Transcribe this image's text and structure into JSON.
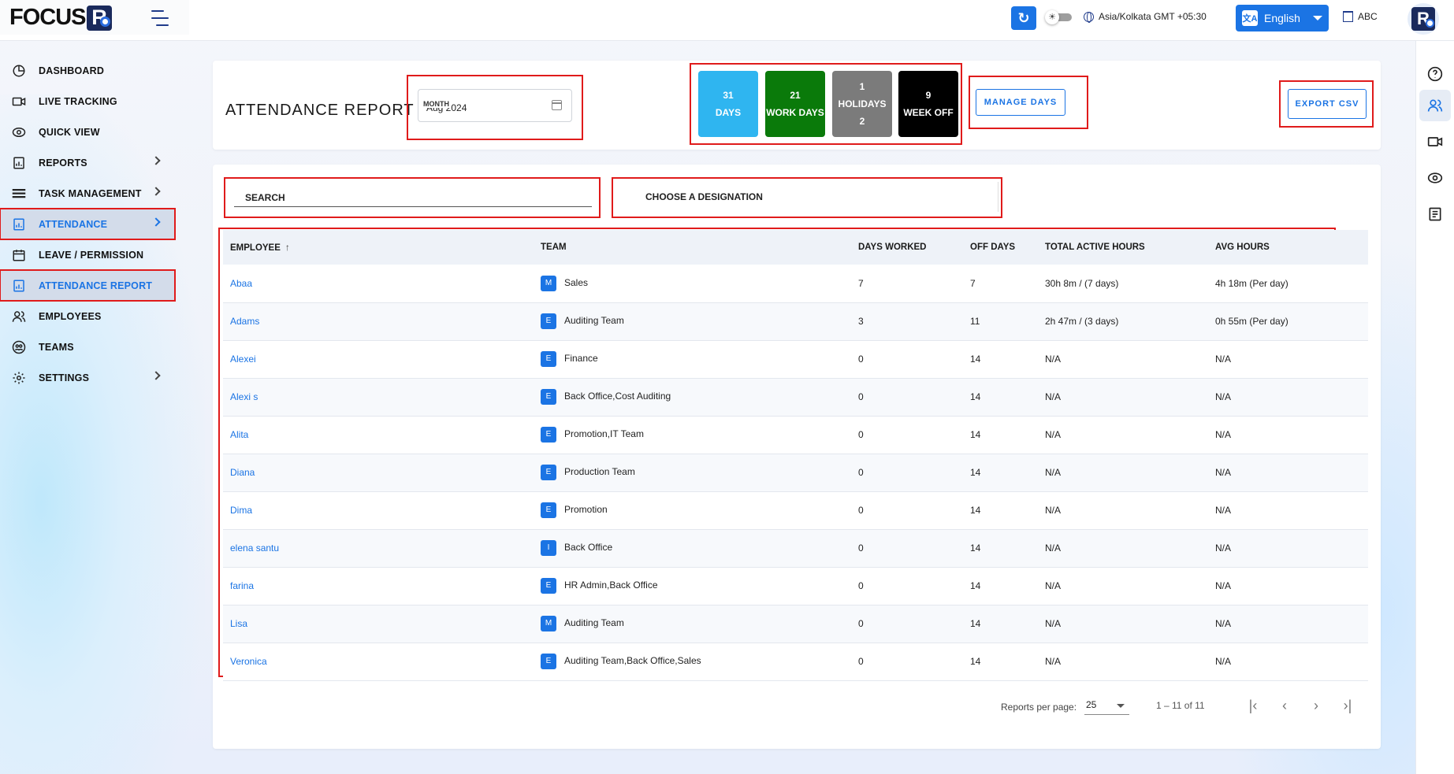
{
  "brand": {
    "logo_text": "FOCUS",
    "logo_mark": "R"
  },
  "header": {
    "timezone": "Asia/Kolkata GMT +05:30",
    "language": "English",
    "organization": "ABC",
    "avatar_mark": "R"
  },
  "sidebar": {
    "items": [
      {
        "label": "DASHBOARD",
        "icon": "dashboard-icon"
      },
      {
        "label": "LIVE TRACKING",
        "icon": "video-icon"
      },
      {
        "label": "QUICK VIEW",
        "icon": "eye-icon"
      },
      {
        "label": "REPORTS",
        "icon": "report-icon"
      },
      {
        "label": "TASK MANAGEMENT",
        "icon": "tasks-icon"
      },
      {
        "label": "ATTENDANCE",
        "icon": "attendance-icon"
      },
      {
        "label": "LEAVE / PERMISSION",
        "icon": "calendar-icon"
      },
      {
        "label": "ATTENDANCE REPORT",
        "icon": "attendance-report-icon"
      },
      {
        "label": "EMPLOYEES",
        "icon": "users-icon"
      },
      {
        "label": "TEAMS",
        "icon": "teams-icon"
      },
      {
        "label": "SETTINGS",
        "icon": "gear-icon"
      }
    ]
  },
  "report": {
    "title": "ATTENDANCE REPORT",
    "month_label": "MONTH",
    "month_value": "Aug 2024",
    "stats": {
      "days_num": "31",
      "days_label": "DAYS",
      "work_num": "21",
      "work_label": "WORK DAYS",
      "hol_num": "1",
      "hol_label": "HOLIDAYS",
      "hol_sub": "2",
      "week_num": "9",
      "week_label": "WEEK OFF"
    },
    "colors": {
      "days": "#2fb5f0",
      "work": "#0a7a0a",
      "holidays": "#7b7b7b",
      "week_off": "#000000",
      "accent": "#1b74e4"
    },
    "manage_days": "MANAGE DAYS",
    "export_csv": "EXPORT CSV"
  },
  "filters": {
    "search_placeholder": "SEARCH",
    "designation": "CHOOSE A DESIGNATION"
  },
  "table": {
    "headers": {
      "employee": "EMPLOYEE",
      "team": "TEAM",
      "days_worked": "DAYS WORKED",
      "off_days": "OFF DAYS",
      "total_active": "TOTAL ACTIVE HOURS",
      "avg_hours": "AVG HOURS"
    },
    "rows": [
      {
        "name": "Abaa",
        "badge": "M",
        "team": "Sales",
        "worked": "7",
        "off": "7",
        "total": "30h 8m / (7 days)",
        "avg": "4h 18m (Per day)"
      },
      {
        "name": "Adams",
        "badge": "E",
        "team": "Auditing Team",
        "worked": "3",
        "off": "11",
        "total": "2h 47m / (3 days)",
        "avg": "0h 55m (Per day)"
      },
      {
        "name": "Alexei",
        "badge": "E",
        "team": "Finance",
        "worked": "0",
        "off": "14",
        "total": "N/A",
        "avg": "N/A"
      },
      {
        "name": "Alexi s",
        "badge": "E",
        "team": "Back Office,Cost Auditing",
        "worked": "0",
        "off": "14",
        "total": "N/A",
        "avg": "N/A"
      },
      {
        "name": "Alita",
        "badge": "E",
        "team": "Promotion,IT Team",
        "worked": "0",
        "off": "14",
        "total": "N/A",
        "avg": "N/A"
      },
      {
        "name": "Diana",
        "badge": "E",
        "team": "Production Team",
        "worked": "0",
        "off": "14",
        "total": "N/A",
        "avg": "N/A"
      },
      {
        "name": "Dima",
        "badge": "E",
        "team": "Promotion",
        "worked": "0",
        "off": "14",
        "total": "N/A",
        "avg": "N/A"
      },
      {
        "name": "elena santu",
        "badge": "I",
        "team": "Back Office",
        "worked": "0",
        "off": "14",
        "total": "N/A",
        "avg": "N/A"
      },
      {
        "name": "farina",
        "badge": "E",
        "team": "HR Admin,Back Office",
        "worked": "0",
        "off": "14",
        "total": "N/A",
        "avg": "N/A"
      },
      {
        "name": "Lisa",
        "badge": "M",
        "team": "Auditing Team",
        "worked": "0",
        "off": "14",
        "total": "N/A",
        "avg": "N/A"
      },
      {
        "name": "Veronica",
        "badge": "E",
        "team": "Auditing Team,Back Office,Sales",
        "worked": "0",
        "off": "14",
        "total": "N/A",
        "avg": "N/A"
      }
    ]
  },
  "pagination": {
    "label": "Reports per page:",
    "per_page": "25",
    "range": "1 – 11 of 11"
  }
}
